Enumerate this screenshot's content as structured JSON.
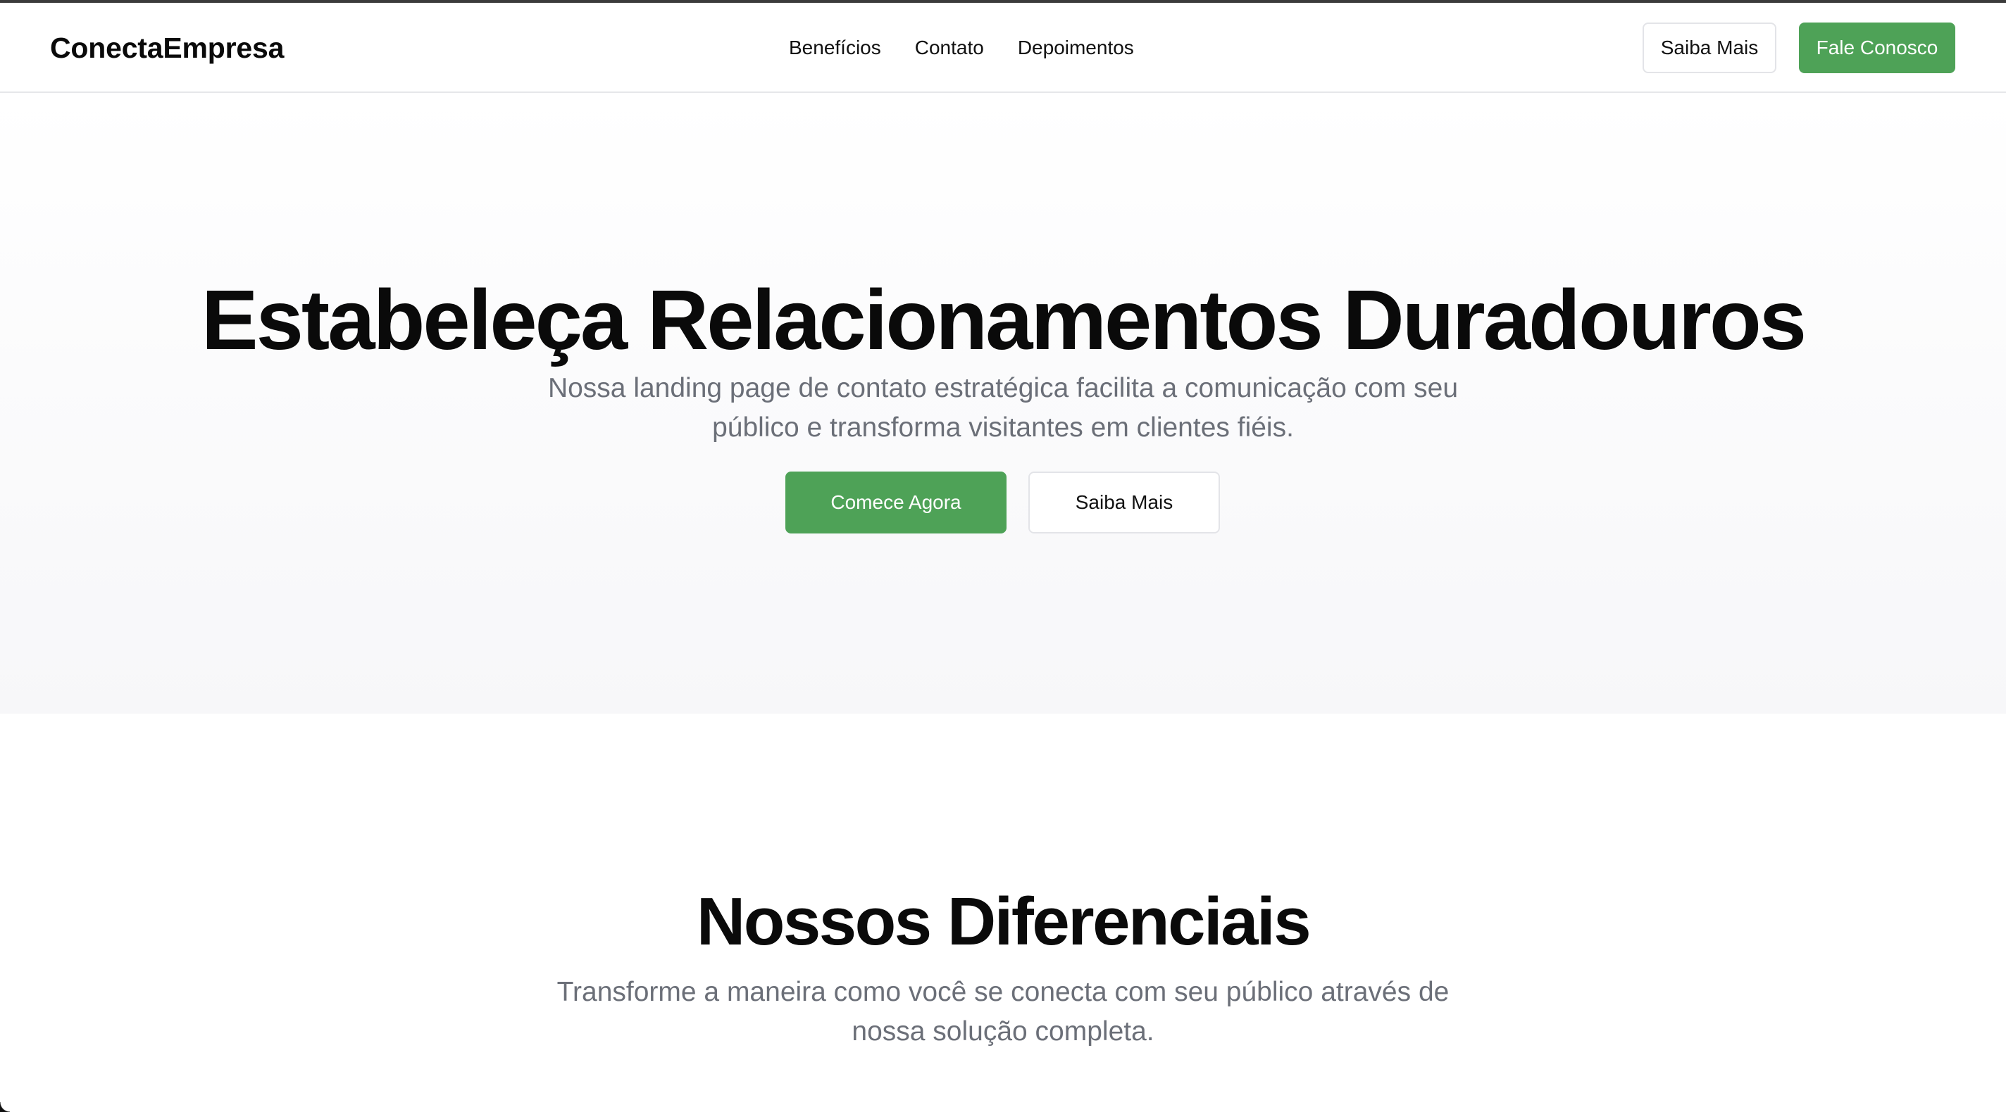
{
  "navbar": {
    "brand": "ConectaEmpresa",
    "links": [
      "Benefícios",
      "Contato",
      "Depoimentos"
    ],
    "secondary_button": "Saiba Mais",
    "primary_button": "Fale Conosco"
  },
  "hero": {
    "title": "Estabeleça Relacionamentos Duradouros",
    "subtitle": "Nossa landing page de contato estratégica facilita a comunicação com seu público e transforma visitantes em clientes fiéis.",
    "primary_button": "Comece Agora",
    "secondary_button": "Saiba Mais"
  },
  "features": {
    "title": "Nossos Diferenciais",
    "subtitle": "Transforme a maneira como você se conecta com seu público através de nossa solução completa."
  },
  "colors": {
    "accent_green": "#4ea257",
    "muted_text": "#6b6f78",
    "border": "#e3e4e8"
  }
}
